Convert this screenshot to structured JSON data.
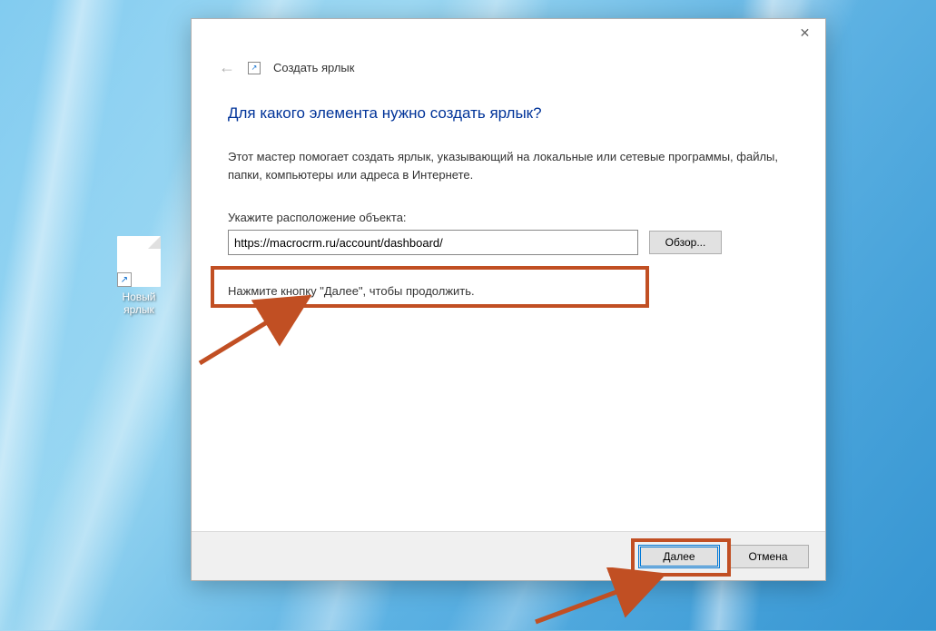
{
  "desktop": {
    "shortcut_label": "Новый ярлык",
    "shortcut_arrow": "↗"
  },
  "window": {
    "back_arrow": "←",
    "close_glyph": "✕",
    "shortcut_glyph": "↗",
    "header_title": "Создать ярлык",
    "heading": "Для какого элемента нужно создать ярлык?",
    "description": "Этот мастер помогает создать ярлык, указывающий на локальные или сетевые программы, файлы, папки, компьютеры или адреса в Интернете.",
    "field_label": "Укажите расположение объекта:",
    "location_value": "https://macrocrm.ru/account/dashboard/",
    "browse_label": "Обзор...",
    "hint": "Нажмите кнопку \"Далее\", чтобы продолжить.",
    "next_label": "Далее",
    "cancel_label": "Отмена"
  },
  "annotations": {
    "highlight_color": "#c14f23"
  }
}
